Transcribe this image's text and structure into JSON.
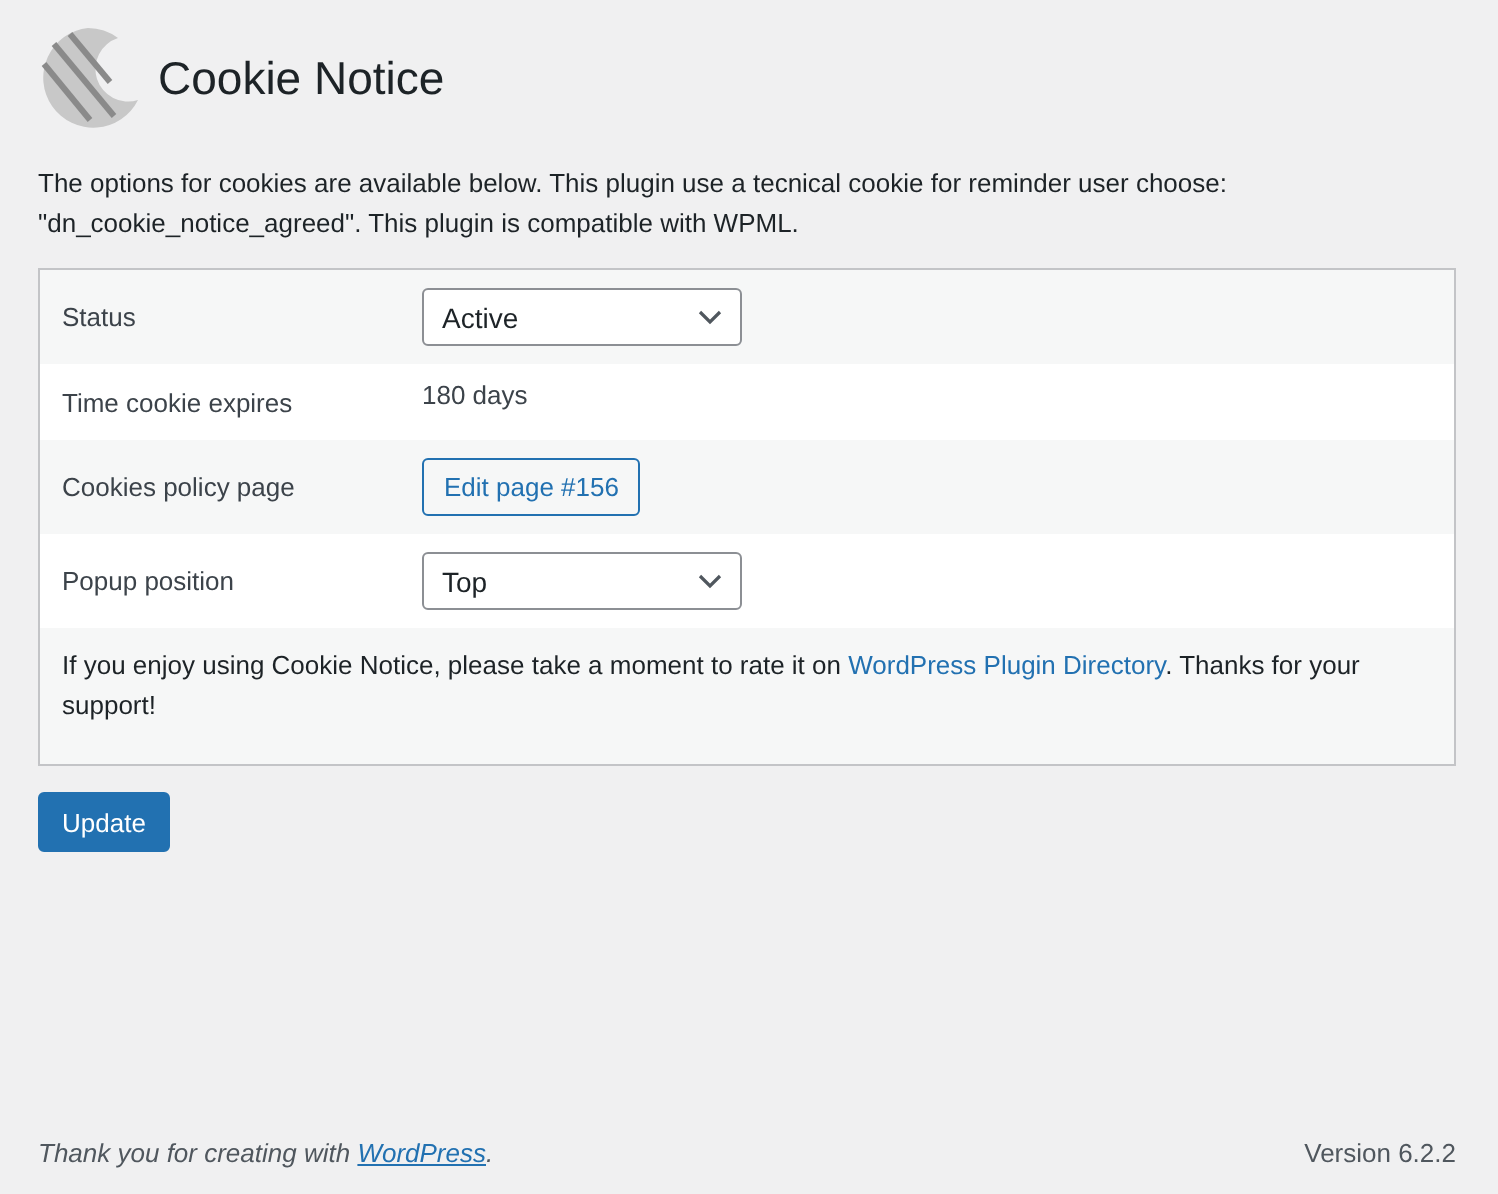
{
  "title": "Cookie Notice",
  "intro": "The options for cookies are available below. This plugin use a tecnical cookie for reminder user choose: \"dn_cookie_notice_agreed\". This plugin is compatible with WPML.",
  "settings": [
    {
      "label": "Status",
      "kind": "select",
      "value": "Active"
    },
    {
      "label": "Time cookie expires",
      "kind": "text",
      "value": "180 days"
    },
    {
      "label": "Cookies policy page",
      "kind": "button",
      "value": "Edit page #156"
    },
    {
      "label": "Popup position",
      "kind": "select",
      "value": "Top"
    }
  ],
  "note": {
    "before": "If you enjoy using Cookie Notice, please take a moment to rate it on ",
    "link": "WordPress Plugin Directory",
    "after": ". Thanks for your support!"
  },
  "submit": "Update",
  "footer": {
    "before": "Thank you for creating with ",
    "link": "WordPress",
    "after": ".",
    "version": "Version 6.2.2"
  }
}
